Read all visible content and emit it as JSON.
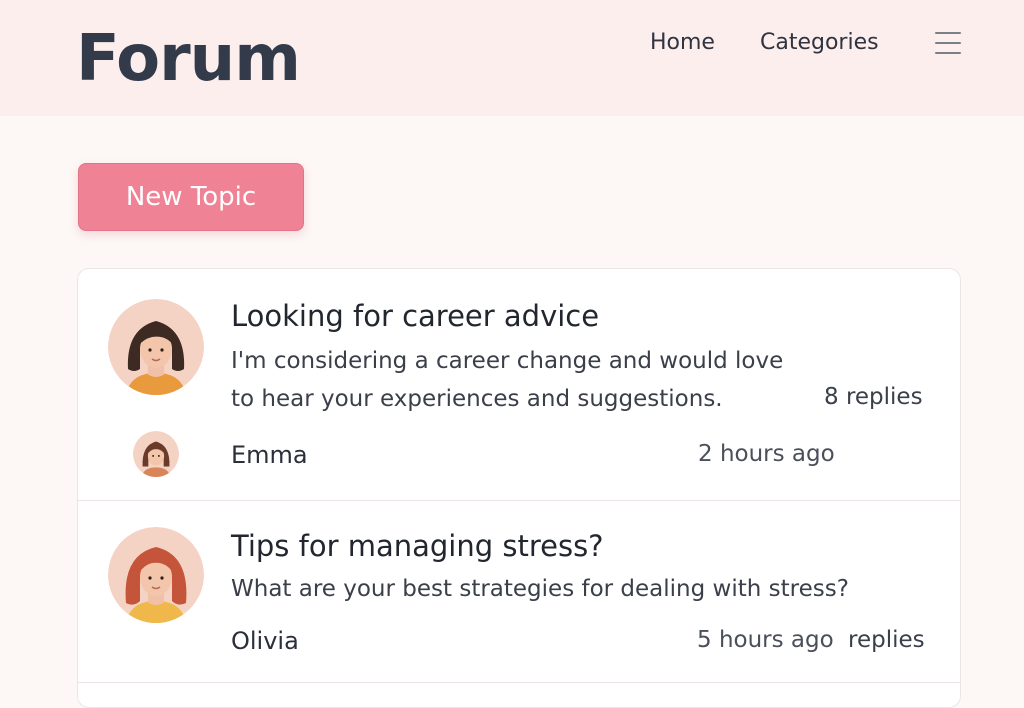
{
  "header": {
    "logo": "Forum",
    "nav": [
      "Home",
      "Categories"
    ],
    "menu_icon": "hamburger-menu-icon"
  },
  "actions": {
    "new_topic_label": "New Topic"
  },
  "topics": [
    {
      "title": "Looking for career advice",
      "excerpt_lines": [
        "I'm considering a career change and would love",
        "to hear your experiences and suggestions."
      ],
      "replies": "8 replies",
      "author": "Emma",
      "time": "2 hours ago",
      "avatar": "woman-dark-hair-avatar"
    },
    {
      "title": "Tips for managing stress?",
      "excerpt_lines": [
        "What are your best strategies for dealing with stress?"
      ],
      "replies": "replies",
      "author": "Olivia",
      "time": "5 hours ago",
      "avatar": "woman-red-hair-avatar"
    }
  ],
  "colors": {
    "header_bg": "#fdeeee",
    "page_bg": "#fdf8f6",
    "accent": "#ef8295",
    "text": "#2a2f3a"
  }
}
